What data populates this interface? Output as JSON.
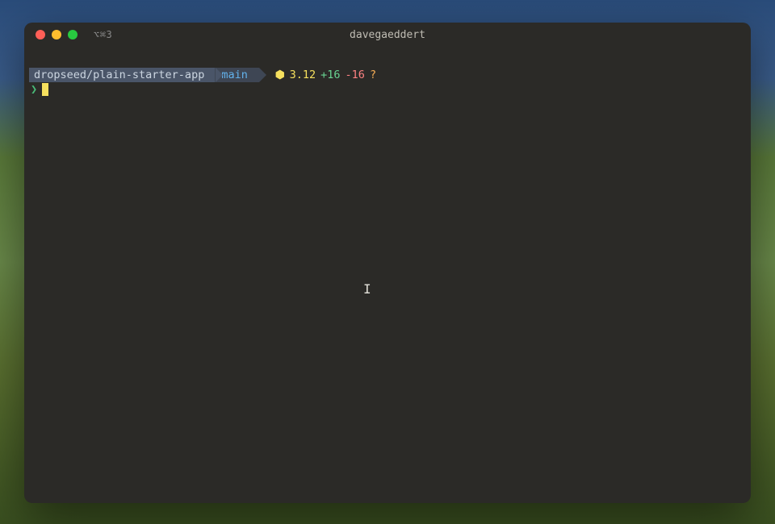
{
  "window": {
    "title": "davegaeddert",
    "shortcut_label": "⌥⌘3"
  },
  "prompt": {
    "repo": "dropseed/plain-starter-app",
    "branch": "main",
    "python_symbol": "⬢",
    "python_version": "3.12",
    "git_additions": "+16",
    "git_deletions": "-16",
    "git_untracked": "?",
    "prompt_char": "❯"
  },
  "cursor_glyph": "𝙸"
}
